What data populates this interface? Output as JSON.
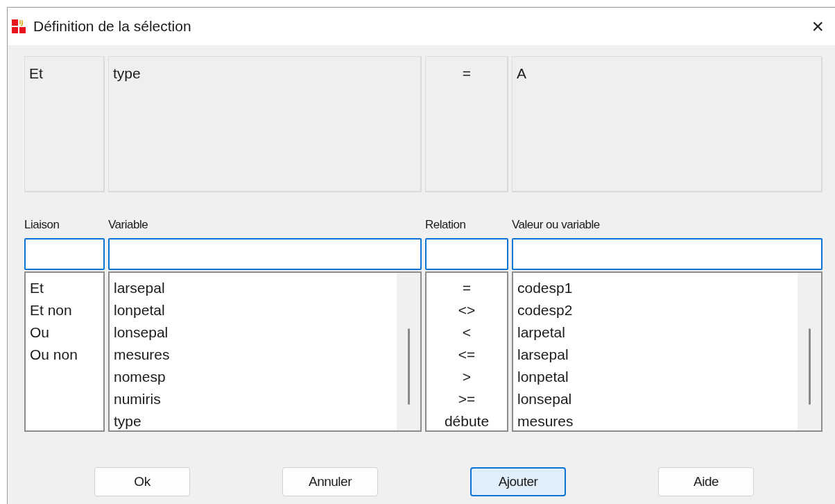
{
  "window": {
    "title": "Définition de la sélection",
    "close": "×"
  },
  "criteria": [
    {
      "kind": "word",
      "text": "Et"
    },
    {
      "kind": "word",
      "text": "type"
    },
    {
      "kind": "operator",
      "text": "="
    },
    {
      "kind": "word",
      "text": "A"
    }
  ],
  "columns": [
    {
      "label": "Liaison",
      "kind": "word",
      "scrollbar": false,
      "items": [
        "Et",
        "Et non",
        "Ou",
        "Ou non"
      ]
    },
    {
      "label": "Variable",
      "kind": "word",
      "scrollbar": true,
      "items": [
        "larsepal",
        "lonpetal",
        "lonsepal",
        "mesures",
        "nomesp",
        "numiris",
        "type"
      ]
    },
    {
      "label": "Relation",
      "kind": "operator",
      "scrollbar": false,
      "items": [
        "=",
        "<>",
        "<",
        "<=",
        ">",
        ">=",
        "débute"
      ]
    },
    {
      "label": "Valeur ou variable",
      "kind": "word",
      "scrollbar": true,
      "items": [
        "codesp1",
        "codesp2",
        "larpetal",
        "larsepal",
        "lonpetal",
        "lonsepal",
        "mesures"
      ]
    }
  ],
  "buttons": [
    {
      "label": "Ok",
      "focused": false
    },
    {
      "label": "Annuler",
      "focused": false
    },
    {
      "label": "Ajouter",
      "focused": true
    },
    {
      "label": "Aide",
      "focused": false
    }
  ]
}
